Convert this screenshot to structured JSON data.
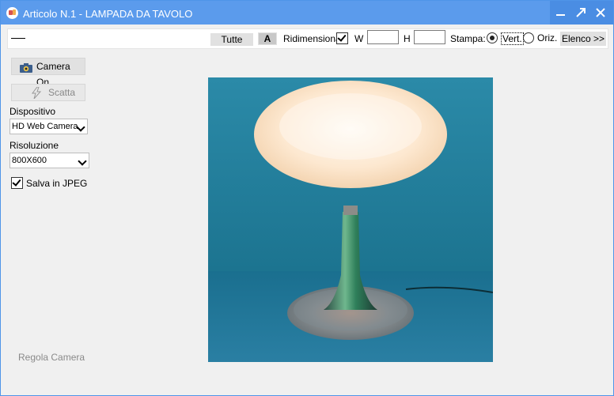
{
  "window": {
    "title": "Articolo N.1 - LAMPADA DA TAVOLO"
  },
  "titlebar_buttons": {
    "minimize": "minimize-icon",
    "maximize": "maximize-icon",
    "close": "close-icon"
  },
  "toolbar": {
    "tutte_label": "Tutte",
    "bold_label": "A",
    "ridimensiona_label": "Ridimensiona",
    "ridimensiona_checked": true,
    "w_label": "W",
    "w_value": "",
    "h_label": "H",
    "h_value": "",
    "stampa_label": "Stampa:",
    "vert_label": "Vert.",
    "oriz_label": "Oriz.",
    "selected_orientation": "Vert.",
    "elenco_label": "Elenco >>"
  },
  "sidebar": {
    "camera_on_label": "Camera On",
    "scatta_label": "Scatta",
    "dispositivo_label": "Dispositivo",
    "dispositivo_value": "HD Web Camera",
    "risoluzione_label": "Risoluzione",
    "risoluzione_value": "800X600",
    "salva_jpeg_label": "Salva in JPEG",
    "salva_jpeg_checked": true,
    "regola_camera_label": "Regola Camera"
  },
  "preview": {
    "subject": "table-lamp-photo"
  },
  "colors": {
    "titlebar": "#5b9bec",
    "background": "#f0f0f0",
    "photo_background": "#1f7d9d"
  }
}
